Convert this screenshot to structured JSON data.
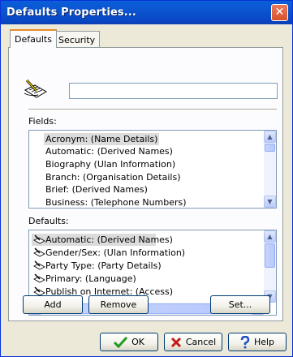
{
  "window": {
    "title": "Defaults Properties...",
    "close_glyph": "✕"
  },
  "tabs": [
    {
      "label": "Defaults",
      "active": true
    },
    {
      "label": "Security",
      "active": false
    }
  ],
  "header": {
    "icon": "pen-paper-icon",
    "name_value": ""
  },
  "fields": {
    "label": "Fields:",
    "items": [
      "Acronym: (Name Details)",
      "Automatic: (Derived Names)",
      "Biography (Ulan Information)",
      "Branch: (Organisation Details)",
      "Brief: (Derived Names)",
      "Business: (Telephone Numbers)"
    ],
    "selected_index": 0
  },
  "defaults": {
    "label": "Defaults:",
    "items": [
      "Automatic: (Derived Names)",
      "Gender/Sex: (Ulan Information)",
      "Party Type: (Party Details)",
      "Primary: (Language)",
      "Publish on Internet: (Access)"
    ],
    "selected_index": 0,
    "item_icon": "check-pen-icon"
  },
  "actions": {
    "add_label": "Add",
    "remove_label": "Remove",
    "set_label": "Set..."
  },
  "footer": {
    "ok_label": "OK",
    "cancel_label": "Cancel",
    "help_label": "Help"
  }
}
